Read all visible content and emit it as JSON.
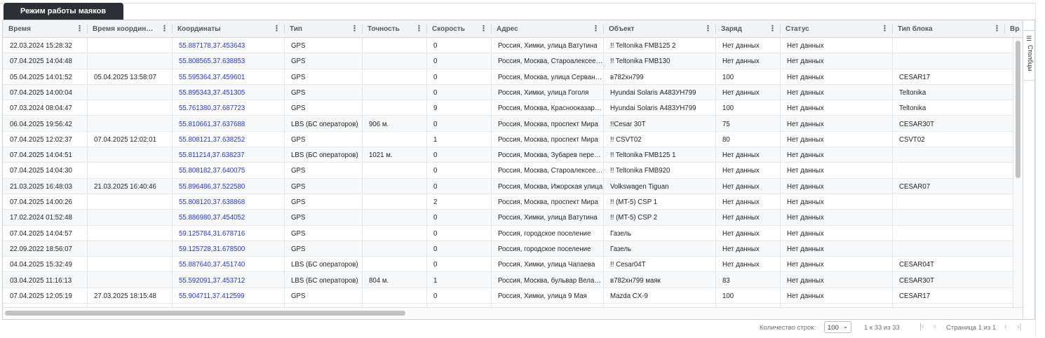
{
  "tab": {
    "label": "Режим работы маяков"
  },
  "columns": [
    {
      "label": "Время"
    },
    {
      "label": "Время координ…"
    },
    {
      "label": "Координаты"
    },
    {
      "label": "Тип"
    },
    {
      "label": "Точность"
    },
    {
      "label": "Скорость"
    },
    {
      "label": "Адрес"
    },
    {
      "label": "Объект"
    },
    {
      "label": "Заряд"
    },
    {
      "label": "Статус"
    },
    {
      "label": "Тип блока"
    },
    {
      "label": "Вре"
    }
  ],
  "rows": [
    {
      "time": "22.03.2024 15:28:32",
      "coord_time": "",
      "coords": "55.887178,37.453643",
      "type": "GPS",
      "accuracy": "",
      "speed": "0",
      "address": "Россия, Химки, улица Ватутина",
      "object": "!! Teltonika FMB125 2",
      "charge": "Нет данных",
      "status": "Нет данных",
      "block": ""
    },
    {
      "time": "07.04.2025 14:04:48",
      "coord_time": "",
      "coords": "55.808565,37.638853",
      "type": "GPS",
      "accuracy": "",
      "speed": "0",
      "address": "Россия, Москва, Староалексеевская",
      "object": "!! Teltonika FMB130",
      "charge": "Нет данных",
      "status": "Нет данных",
      "block": ""
    },
    {
      "time": "05.04.2025 14:01:52",
      "coord_time": "05.04.2025 13:58:07",
      "coords": "55.595364,37.459601",
      "type": "GPS",
      "accuracy": "",
      "speed": "0",
      "address": "Россия, Москва, улица Сервантеса",
      "object": "в782хн799",
      "charge": "100",
      "status": "Нет данных",
      "block": "CESAR17"
    },
    {
      "time": "07.04.2025 14:00:04",
      "coord_time": "",
      "coords": "55.895343,37.451305",
      "type": "GPS",
      "accuracy": "",
      "speed": "0",
      "address": "Россия, Химки, улица Гоголя",
      "object": "Hyundai Solaris А483УН799",
      "charge": "Нет данных",
      "status": "Нет данных",
      "block": "Teltonika"
    },
    {
      "time": "07.03.2024 08:04:47",
      "coord_time": "",
      "coords": "55.761380,37.687723",
      "type": "GPS",
      "accuracy": "",
      "speed": "9",
      "address": "Россия, Москва, Краснооказарменная",
      "object": "Hyundai Solaris А483УН799",
      "charge": "100",
      "status": "Нет данных",
      "block": "Teltonika"
    },
    {
      "time": "06.04.2025 19:56:42",
      "coord_time": "",
      "coords": "55.810661,37.637688",
      "type": "LBS (БС операторов)",
      "accuracy": "906 м.",
      "speed": "0",
      "address": "Россия, Москва, проспект Мира",
      "object": "!!Cesar 30T",
      "charge": "75",
      "status": "Нет данных",
      "block": "CESAR30T"
    },
    {
      "time": "07.04.2025 12:02:37",
      "coord_time": "07.04.2025 12:02:01",
      "coords": "55.808121,37.638252",
      "type": "GPS",
      "accuracy": "",
      "speed": "1",
      "address": "Россия, Москва, проспект Мира",
      "object": "!! CSVT02",
      "charge": "80",
      "status": "Нет данных",
      "block": "CSVT02"
    },
    {
      "time": "07.04.2025 14:04:51",
      "coord_time": "",
      "coords": "55.811214,37.638237",
      "type": "LBS (БС операторов)",
      "accuracy": "1021 м.",
      "speed": "0",
      "address": "Россия, Москва, Зубарев переулок",
      "object": "!! Teltonika FMB125 1",
      "charge": "Нет данных",
      "status": "Нет данных",
      "block": ""
    },
    {
      "time": "07.04.2025 14:04:30",
      "coord_time": "",
      "coords": "55.808182,37.640075",
      "type": "GPS",
      "accuracy": "",
      "speed": "0",
      "address": "Россия, Москва, Староалексеевская",
      "object": "!! Teltonika FMB920",
      "charge": "Нет данных",
      "status": "Нет данных",
      "block": ""
    },
    {
      "time": "21.03.2025 16:48:03",
      "coord_time": "21.03.2025 16:40:46",
      "coords": "55.896486,37.522580",
      "type": "GPS",
      "accuracy": "",
      "speed": "0",
      "address": "Россия, Москва, Ижорская улица",
      "object": "Volkswagen Tiguan",
      "charge": "Нет данных",
      "status": "Нет данных",
      "block": "CESAR07"
    },
    {
      "time": "07.04.2025 14:00:26",
      "coord_time": "",
      "coords": "55.808120,37.638868",
      "type": "GPS",
      "accuracy": "",
      "speed": "2",
      "address": "Россия, Москва, проспект Мира",
      "object": "!! (MT-5) CSP 1",
      "charge": "Нет данных",
      "status": "Нет данных",
      "block": ""
    },
    {
      "time": "17.02.2024 01:52:48",
      "coord_time": "",
      "coords": "55.886980,37.454052",
      "type": "GPS",
      "accuracy": "",
      "speed": "0",
      "address": "Россия, Химки, улица Ватутина",
      "object": "!! (MT-5) CSP 2",
      "charge": "Нет данных",
      "status": "Нет данных",
      "block": ""
    },
    {
      "time": "07.04.2025 14:04:57",
      "coord_time": "",
      "coords": "59.125784,31.678716",
      "type": "GPS",
      "accuracy": "",
      "speed": "0",
      "address": "Россия, городское поселение",
      "object": "Газель",
      "charge": "Нет данных",
      "status": "Нет данных",
      "block": ""
    },
    {
      "time": "22.09.2022 18:56:07",
      "coord_time": "",
      "coords": "59.125728,31.678500",
      "type": "GPS",
      "accuracy": "",
      "speed": "0",
      "address": "Россия, городское поселение",
      "object": "Газель",
      "charge": "Нет данных",
      "status": "Нет данных",
      "block": ""
    },
    {
      "time": "04.04.2025 15:32:49",
      "coord_time": "",
      "coords": "55.887640,37.451740",
      "type": "LBS (БС операторов)",
      "accuracy": "",
      "speed": "0",
      "address": "Россия, Химки, улица Чапаева",
      "object": "!! Cesar04T",
      "charge": "Нет данных",
      "status": "Нет данных",
      "block": "CESAR04T"
    },
    {
      "time": "03.04.2025 11:16:13",
      "coord_time": "",
      "coords": "55.592091,37.453712",
      "type": "LBS (БС операторов)",
      "accuracy": "804 м.",
      "speed": "1",
      "address": "Россия, Москва, бульвар Веласкеса",
      "object": "в782хн799 маяк",
      "charge": "83",
      "status": "Нет данных",
      "block": "CESAR30T"
    },
    {
      "time": "07.04.2025 12:05:19",
      "coord_time": "27.03.2025 18:15:48",
      "coords": "55.904711,37.412599",
      "type": "GPS",
      "accuracy": "",
      "speed": "0",
      "address": "Россия, Химки, улица 9 Мая",
      "object": "Mazda CX-9",
      "charge": "100",
      "status": "Нет данных",
      "block": "CESAR17"
    }
  ],
  "side_panel": {
    "label": "Столбцы"
  },
  "footer": {
    "rows_label": "Количество строк:",
    "rows_value": "100",
    "range": "1 к 33 из 33",
    "page": "Страница 1 из 1"
  }
}
